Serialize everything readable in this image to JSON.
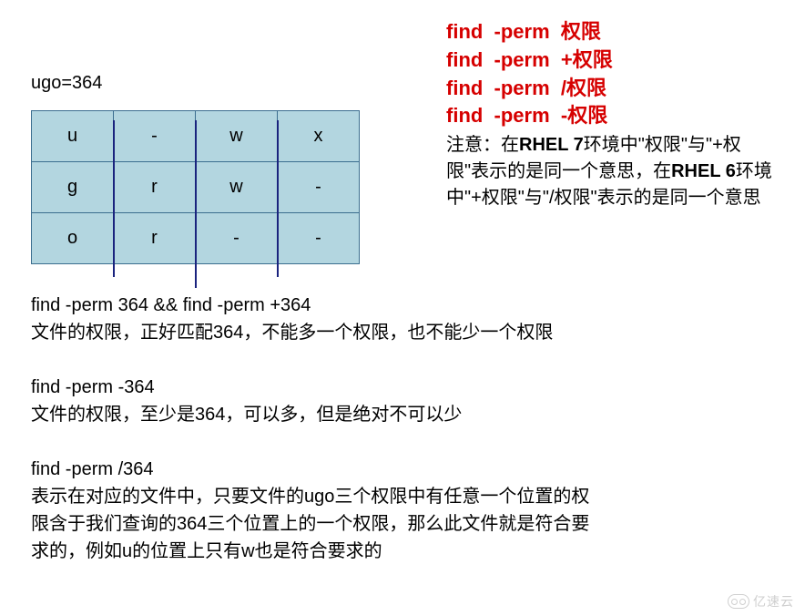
{
  "title": "ugo=364",
  "table": {
    "rows": [
      [
        "u",
        "-",
        "w",
        "x"
      ],
      [
        "g",
        "r",
        "w",
        "-"
      ],
      [
        "o",
        "r",
        "-",
        "-"
      ]
    ]
  },
  "redCommands": [
    "find  -perm  权限",
    "find  -perm  +权限",
    "find  -perm  /权限",
    "find  -perm  -权限"
  ],
  "note": {
    "prefix": "注意：在",
    "b1": "RHEL 7",
    "mid1": "环境中\"权限\"与\"+权限\"表示的是同一个意思，在",
    "b2": "RHEL 6",
    "mid2": "环境中\"+权限\"与\"/权限\"表示的是同一个意思"
  },
  "sections": [
    {
      "cmd": "find  -perm  364  &&  find  -perm  +364",
      "desc": "文件的权限，正好匹配364，不能多一个权限，也不能少一个权限"
    },
    {
      "cmd": "find  -perm  -364",
      "desc": "文件的权限，至少是364，可以多，但是绝对不可以少"
    },
    {
      "cmd": "find  -perm  /364",
      "desc": "表示在对应的文件中，只要文件的ugo三个权限中有任意一个位置的权限含于我们查询的364三个位置上的一个权限，那么此文件就是符合要求的，例如u的位置上只有w也是符合要求的"
    }
  ],
  "watermark": "亿速云"
}
